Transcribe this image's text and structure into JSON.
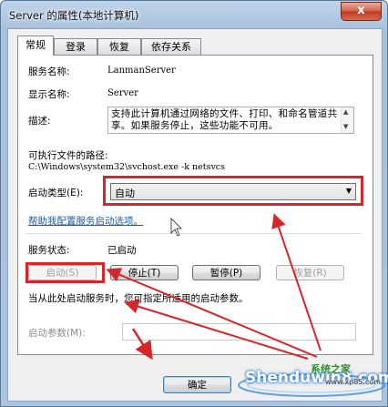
{
  "window": {
    "title": "Server 的属性(本地计算机)",
    "close_glyph": "x"
  },
  "tabs": [
    {
      "label": "常规",
      "active": true
    },
    {
      "label": "登录"
    },
    {
      "label": "恢复"
    },
    {
      "label": "依存关系"
    }
  ],
  "general": {
    "service_name_label": "服务名称:",
    "service_name_value": "LanmanServer",
    "display_name_label": "显示名称:",
    "display_name_value": "Server",
    "description_label": "描述:",
    "description_value": "支持此计算机通过网络的文件、打印、和命名管道共享。如果服务停止，这些功能不可用。",
    "exe_path_label": "可执行文件的路径:",
    "exe_path_value": "C:\\Windows\\system32\\svchost.exe -k netsvcs",
    "startup_type_label": "启动类型(E):",
    "startup_type_value": "自动",
    "help_link": "帮助我配置服务启动选项。",
    "status_label": "服务状态:",
    "status_value": "已启动",
    "buttons": {
      "start": "启动(S)",
      "stop": "停止(T)",
      "pause": "暂停(P)",
      "resume": "恢复(R)"
    },
    "hint": "当从此处启动服务时，您可指定所适用的启动参数。",
    "start_params_label": "启动参数(M):",
    "start_params_value": ""
  },
  "footer": {
    "ok": "确定"
  },
  "watermark": {
    "brand_text": "Shenduwin8.com",
    "cn_text": "系统之家",
    "url_text": "www.xp85.com"
  },
  "colors": {
    "annotation_red": "#d7262b",
    "link_blue": "#1a5ea8"
  }
}
